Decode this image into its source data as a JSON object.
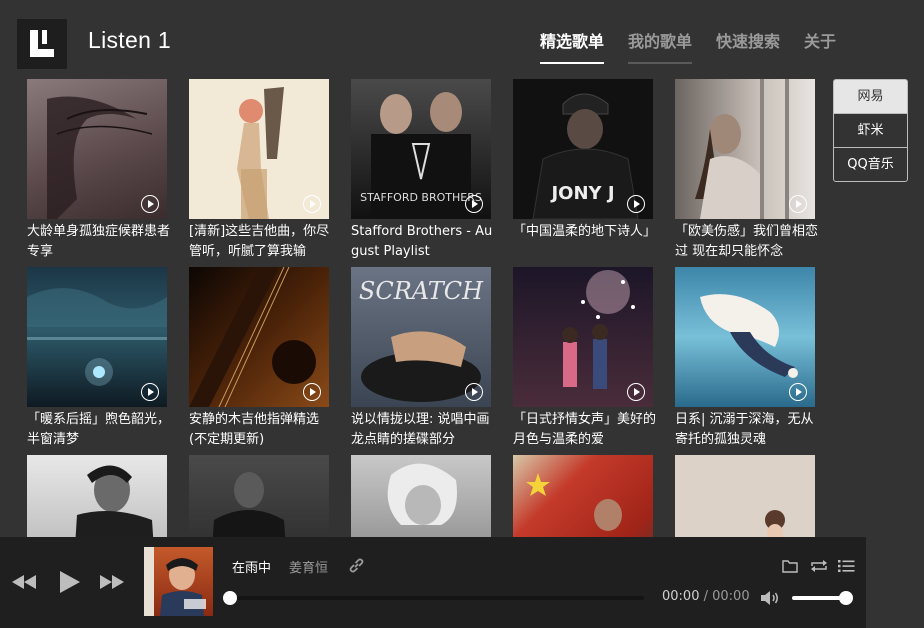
{
  "app": {
    "title": "Listen 1"
  },
  "nav": [
    {
      "label": "精选歌单",
      "active": true
    },
    {
      "label": "我的歌单",
      "active": false
    },
    {
      "label": "快速搜索",
      "active": false
    },
    {
      "label": "关于",
      "active": false
    }
  ],
  "sources": [
    {
      "label": "网易",
      "active": true
    },
    {
      "label": "虾米",
      "active": false
    },
    {
      "label": "QQ音乐",
      "active": false
    }
  ],
  "playlists": [
    {
      "title": "大龄单身孤独症候群患者专享",
      "bg": "#6d5a5c"
    },
    {
      "title": "[清新]这些吉他曲，你尽管听，听腻了算我输",
      "bg": "#efe6d2"
    },
    {
      "title": "Stafford Brothers - August Playlist",
      "bg": "#2a2a2a"
    },
    {
      "title": "「中国温柔的地下诗人」",
      "bg": "#1a1a1a"
    },
    {
      "title": "「欧美伤感」我们曾相恋过 现在却只能怀念",
      "bg": "#b6aaa0"
    },
    {
      "title": "「暖系后摇」煦色韶光，半窗清梦",
      "bg": "#2c4a5c"
    },
    {
      "title": "安静的木吉他指弹精选(不定期更新)",
      "bg": "#5a2a10"
    },
    {
      "title": "说以情拢以理: 说唱中画龙点睛的搓碟部分",
      "bg": "#566070"
    },
    {
      "title": "「日式抒情女声」美好的月色与温柔的爱",
      "bg": "#3a2c3c"
    },
    {
      "title": "日系| 沉溺于深海，无从寄托的孤独灵魂",
      "bg": "#5a96b8"
    },
    {
      "title": "",
      "bg": "#dcdcdc"
    },
    {
      "title": "",
      "bg": "#3a3a3a"
    },
    {
      "title": "",
      "bg": "#9a9a9a"
    },
    {
      "title": "",
      "bg": "#c43a2a"
    },
    {
      "title": "",
      "bg": "#d8cdc4"
    }
  ],
  "player": {
    "song_title": "在雨中",
    "artist": "姜育恒",
    "current_time": "00:00",
    "separator": " / ",
    "total_time": "00:00",
    "progress": 0,
    "volume": 0.9
  },
  "colors": {
    "background": "#333333",
    "player_bg": "#1f1f1f"
  }
}
